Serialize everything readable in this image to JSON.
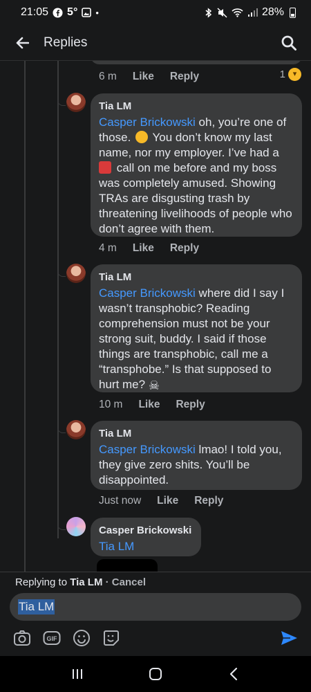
{
  "status_bar": {
    "time": "21:05",
    "temperature": "5°",
    "battery": "28%",
    "icons": [
      "facebook-icon",
      "gallery-icon",
      "dot-icon",
      "bluetooth-icon",
      "mute-icon",
      "wifi-icon",
      "signal-icon",
      "battery-icon"
    ]
  },
  "header": {
    "title": "Replies",
    "icons": [
      "back-arrow-icon",
      "search-icon"
    ]
  },
  "top_comment": {
    "time": "6 m",
    "like": "Like",
    "reply": "Reply",
    "reaction_count": "1"
  },
  "comments": [
    {
      "author": "Tia LM",
      "mention": "Casper Brickowski",
      "text_a": " oh, you’re one of those. ",
      "text_b": " You don’t know my last name, nor my employer. I’ve had a ",
      "text_c": " call on me before and my boss was completely amused. Showing TRAs are disgusting trash by threatening livelihoods of people who don’t agree with them.",
      "time": "4 m",
      "like": "Like",
      "reply": "Reply"
    },
    {
      "author": "Tia LM",
      "mention": "Casper Brickowski",
      "text_a": " where did I say I wasn’t transphobic? Reading comprehension must not be your strong suit, buddy. I said if those things are transphobic, call me a “transphobe.” Is that supposed to hurt me? ",
      "time": "10 m",
      "like": "Like",
      "reply": "Reply"
    },
    {
      "author": "Tia LM",
      "mention": "Casper Brickowski",
      "text_a": " lmao! I told you, they give zero shits. You’ll be disappointed.",
      "time": "Just now",
      "like": "Like",
      "reply": "Reply"
    },
    {
      "author": "Casper Brickowski",
      "mention": "Tia LM"
    }
  ],
  "composer": {
    "replying_prefix": "Replying to ",
    "replying_name": "Tia LM",
    "separator": " · ",
    "cancel": "Cancel",
    "value": "Tia LM",
    "toolbar_icons": [
      "camera-icon",
      "gif-icon",
      "emoji-icon",
      "sticker-icon",
      "send-icon"
    ]
  },
  "nav_bar": {
    "icons": [
      "recent-apps-icon",
      "home-icon",
      "back-icon"
    ]
  },
  "colors": {
    "background": "#18191a",
    "bubble": "#3a3b3c",
    "mention": "#4599ff",
    "send": "#2d88ff"
  }
}
